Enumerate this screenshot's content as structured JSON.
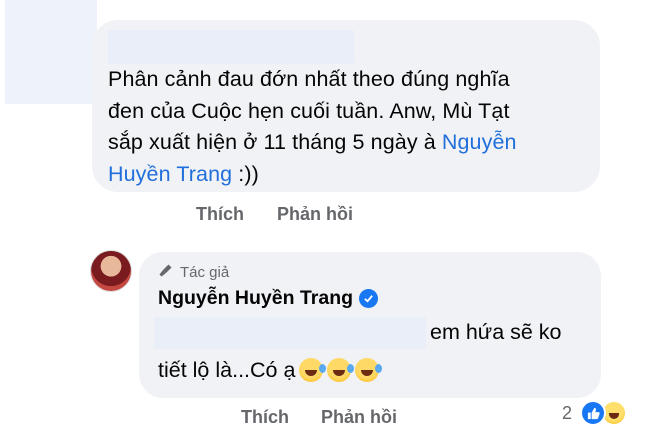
{
  "comment": {
    "line1": "Phân cảnh đau đớn nhất theo đúng nghĩa",
    "line2": "đen của Cuộc hẹn cuối tuần. Anw, Mù Tạt",
    "line3_prefix": "sắp xuất hiện ở 11 tháng 5 ngày à ",
    "tag_part1": "Nguyễn",
    "tag_part2": "Huyền Trang",
    "line4_suffix": " :))",
    "like_label": "Thích",
    "reply_label": "Phản hồi"
  },
  "reply": {
    "author_badge": "Tác giả",
    "name": "Nguyễn Huyền Trang",
    "text_line1": "em hứa sẽ ko",
    "text_line2": "tiết lộ là...Có ạ",
    "emoji_name": "rolling-on-floor-laughing",
    "like_label": "Thích",
    "reply_label": "Phản hồi",
    "reaction_count": "2",
    "reactions": [
      "like",
      "haha"
    ]
  },
  "colors": {
    "bubble": "#f0f2f5",
    "tag": "#216fdb",
    "secondary_text": "#65676b",
    "verified": "#1877f2"
  }
}
